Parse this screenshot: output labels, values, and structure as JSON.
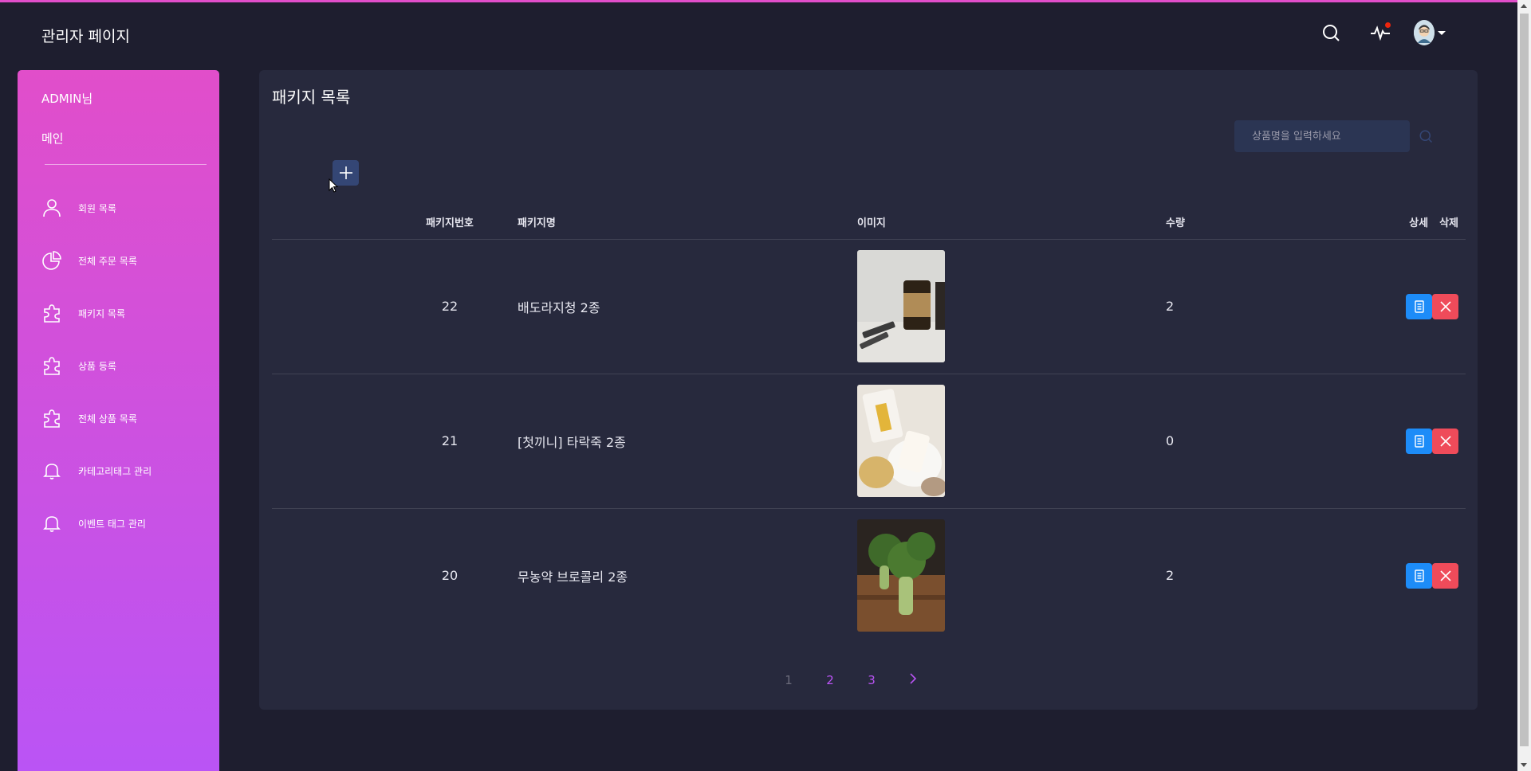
{
  "header": {
    "brand": "관리자 페이지",
    "icons": [
      "search-icon",
      "activity-icon",
      "avatar"
    ]
  },
  "sidebar": {
    "user_label": "ADMIN님",
    "main_label": "메인",
    "items": [
      {
        "label": "회원 목록",
        "icon": "user-icon"
      },
      {
        "label": "전체 주문 목록",
        "icon": "chart-pie-icon"
      },
      {
        "label": "패키지 목록",
        "icon": "puzzle-icon"
      },
      {
        "label": "상품 등록",
        "icon": "puzzle-icon"
      },
      {
        "label": "전체 상품 목록",
        "icon": "puzzle-icon"
      },
      {
        "label": "카테고리태그 관리",
        "icon": "bell-icon"
      },
      {
        "label": "이벤트 태그 관리",
        "icon": "bell-icon"
      }
    ]
  },
  "main": {
    "title": "패키지 목록",
    "search_placeholder": "상품명을 입력하세요",
    "table": {
      "headers": {
        "no": "패키지번호",
        "name": "패키지명",
        "image": "이미지",
        "qty": "수량",
        "detail": "상세",
        "delete": "삭제"
      },
      "rows": [
        {
          "no": "22",
          "name": "배도라지청 2종",
          "qty": "2",
          "image_desc": "jar-product"
        },
        {
          "no": "21",
          "name": "[첫끼니] 타락죽 2종",
          "qty": "0",
          "image_desc": "porridge-pouch"
        },
        {
          "no": "20",
          "name": "무농약 브로콜리 2종",
          "qty": "2",
          "image_desc": "broccoli"
        }
      ]
    },
    "pagination": {
      "pages": [
        "1",
        "2",
        "3"
      ],
      "current": "1"
    }
  },
  "colors": {
    "background": "#1e1e2f",
    "card": "#27293d",
    "sidebar_gradient_start": "#e14eca",
    "sidebar_gradient_end": "#ba54f5",
    "detail_button": "#1d8cf8",
    "delete_button": "#ef4b5a",
    "pager_link": "#ba54f5"
  }
}
